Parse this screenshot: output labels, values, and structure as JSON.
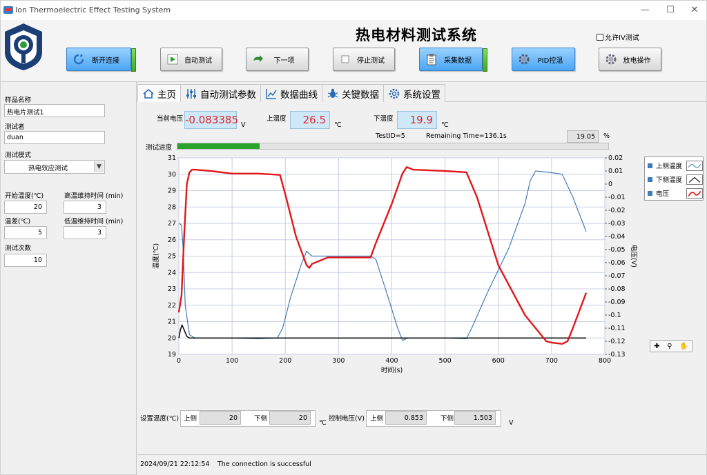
{
  "window": {
    "title": "Ion Thermoelectric Effect Testing System"
  },
  "header": {
    "system_title": "热电材料测试系统",
    "allow_iv_label": "允许IV测试",
    "buttons": [
      {
        "label": "断开连接",
        "icon": "refresh-icon"
      },
      {
        "label": "自动测试",
        "icon": "play-icon"
      },
      {
        "label": "下一项",
        "icon": "next-arrow-icon"
      },
      {
        "label": "停止测试",
        "icon": "stop-icon"
      },
      {
        "label": "采集数据",
        "icon": "clipboard-icon"
      },
      {
        "label": "PID控温",
        "icon": "gear-icon"
      },
      {
        "label": "放电操作",
        "icon": "gear-icon"
      }
    ]
  },
  "left": {
    "sample_name_label": "样品名称",
    "sample_name": "热电片测试1",
    "tester_label": "测试者",
    "tester": "duan",
    "mode_label": "测试模式",
    "mode": "热电效应测试",
    "start_temp_label": "开始温度(℃)",
    "start_temp": "20",
    "high_hold_label": "高温维持时间 (min)",
    "high_hold": "3",
    "temp_diff_label": "温差(℃)",
    "temp_diff": "5",
    "low_hold_label": "低温维持时间 (min)",
    "low_hold": "3",
    "test_count_label": "测试次数",
    "test_count": "10"
  },
  "tabs": [
    {
      "label": "主页",
      "icon": "home-icon"
    },
    {
      "label": "自动测试参数",
      "icon": "sliders-icon"
    },
    {
      "label": "数据曲线",
      "icon": "line-chart-icon"
    },
    {
      "label": "关键数据",
      "icon": "bug-icon"
    },
    {
      "label": "系统设置",
      "icon": "gear-icon"
    }
  ],
  "readouts": {
    "voltage_label": "当前电压",
    "voltage": "-0.083385",
    "voltage_unit": "V",
    "upper_temp_label": "上温度",
    "upper_temp": "26.5",
    "lower_temp_label": "下温度",
    "lower_temp": "19.9",
    "temp_unit": "℃",
    "test_id": "TestID=5",
    "remaining": "Remaining Time=136.1s",
    "percent": "19.05",
    "percent_unit": "%",
    "progress_label": "测试进度",
    "progress_fraction": 0.19
  },
  "colors": {
    "upper_temp": "#3f7cb5",
    "lower_temp": "#111111",
    "voltage": "#e0171b",
    "readout_text": "#e0262a",
    "progress": "#2aa32a"
  },
  "chart_data": {
    "type": "line",
    "xlabel": "时间(s)",
    "ylabel": "温度(℃)",
    "y2label": "电压(V)",
    "xlim": [
      0,
      800
    ],
    "ylim": [
      19,
      31
    ],
    "y2lim": [
      -0.13,
      0.02
    ],
    "x_ticks": [
      "0",
      "100",
      "200",
      "300",
      "400",
      "500",
      "600",
      "700",
      "800"
    ],
    "y_ticks": [
      "19",
      "20",
      "21",
      "22",
      "23",
      "24",
      "25",
      "26",
      "27",
      "28",
      "29",
      "30",
      "31"
    ],
    "y2_ticks": [
      "0.02",
      "0.01",
      "0",
      "-0.01",
      "-0.02",
      "-0.03",
      "-0.04",
      "-0.05",
      "-0.06",
      "-0.07",
      "-0.08",
      "-0.09",
      "-0.1",
      "-0.11",
      "-0.12",
      "-0.13"
    ],
    "grid": true,
    "legend_position": "right",
    "series": [
      {
        "name": "上侧温度",
        "axis": "left",
        "x": [
          0,
          5,
          8,
          12,
          20,
          30,
          50,
          100,
          150,
          185,
          195,
          210,
          230,
          240,
          250,
          280,
          320,
          360,
          370,
          390,
          410,
          420,
          430,
          470,
          500,
          540,
          550,
          580,
          620,
          650,
          660,
          670,
          700,
          720,
          740,
          765
        ],
        "y": [
          27.0,
          26.9,
          25.5,
          22.0,
          20.2,
          20.0,
          20.0,
          20.0,
          19.95,
          20.0,
          20.6,
          22.5,
          24.5,
          25.3,
          25.0,
          25.0,
          25.0,
          25.0,
          24.8,
          22.8,
          20.7,
          19.85,
          20.0,
          20.0,
          20.0,
          19.95,
          20.6,
          22.8,
          25.5,
          28.2,
          29.6,
          30.2,
          30.1,
          30.0,
          28.6,
          26.5
        ]
      },
      {
        "name": "下侧温度",
        "axis": "left",
        "x": [
          0,
          3,
          6,
          10,
          15,
          20,
          30,
          60,
          100,
          200,
          300,
          400,
          500,
          600,
          700,
          765
        ],
        "y": [
          20.0,
          20.5,
          20.8,
          20.5,
          20.1,
          20.0,
          20.0,
          20.0,
          20.0,
          20.0,
          20.0,
          20.0,
          20.0,
          20.0,
          20.0,
          20.0
        ]
      },
      {
        "name": "电压",
        "axis": "right",
        "x": [
          0,
          5,
          10,
          15,
          20,
          25,
          30,
          60,
          100,
          150,
          190,
          200,
          220,
          240,
          245,
          250,
          280,
          320,
          360,
          370,
          400,
          420,
          428,
          440,
          500,
          540,
          560,
          600,
          650,
          690,
          700,
          720,
          730,
          740,
          765
        ],
        "y": [
          -0.098,
          -0.085,
          -0.04,
          0.0,
          0.009,
          0.011,
          0.011,
          0.01,
          0.008,
          0.008,
          0.007,
          -0.008,
          -0.04,
          -0.062,
          -0.064,
          -0.061,
          -0.056,
          -0.056,
          -0.056,
          -0.045,
          -0.015,
          0.008,
          0.013,
          0.011,
          0.01,
          0.009,
          -0.01,
          -0.062,
          -0.1,
          -0.12,
          -0.121,
          -0.122,
          -0.12,
          -0.11,
          -0.083
        ]
      }
    ]
  },
  "legend": {
    "upper": "上侧温度",
    "lower": "下侧温度",
    "voltage": "电压"
  },
  "setpoints": {
    "set_temp_label": "设置温度(℃)",
    "upper_label": "上侧",
    "upper_value": "20",
    "lower_label": "下侧",
    "lower_value": "20",
    "temp_unit": "℃",
    "ctrl_voltage_label": "控制电压(V)",
    "ctrl_upper_label": "上侧",
    "ctrl_upper_value": "0.853",
    "ctrl_lower_label": "下侧",
    "ctrl_lower_value": "1.503",
    "voltage_unit": "V"
  },
  "status": {
    "timestamp": "2024/09/21 22:12:54",
    "message": "The connection is successful"
  }
}
